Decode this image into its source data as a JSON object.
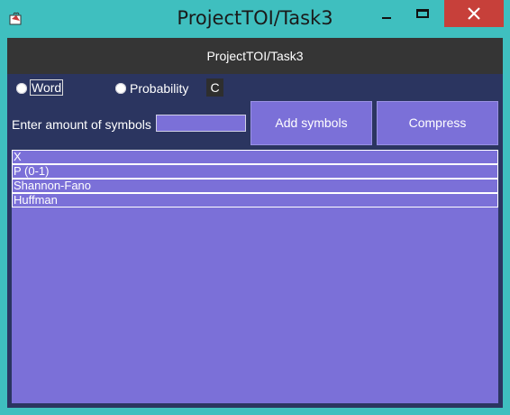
{
  "window": {
    "title": "ProjectTOI/Task3",
    "app_icon": "java-cup-icon",
    "controls": [
      "minimize-icon",
      "maximize-icon",
      "close-icon"
    ],
    "close_color": "#c7403a",
    "border_color": "#3fbfbf"
  },
  "header": {
    "title": "ProjectTOI/Task3"
  },
  "mode": {
    "word_label": "Word",
    "probability_label": "Probability",
    "c_button_label": "C"
  },
  "symbols": {
    "amount_label": "Enter amount of symbols",
    "amount_value": "",
    "add_button_label": "Add symbols",
    "compress_button_label": "Compress"
  },
  "table": {
    "rows": [
      "X",
      "P (0-1)",
      "Shannon-Fano",
      "Huffman"
    ]
  },
  "colors": {
    "panel_background": "#2b3560",
    "accent": "#7b70d8",
    "header_background": "#353535"
  }
}
